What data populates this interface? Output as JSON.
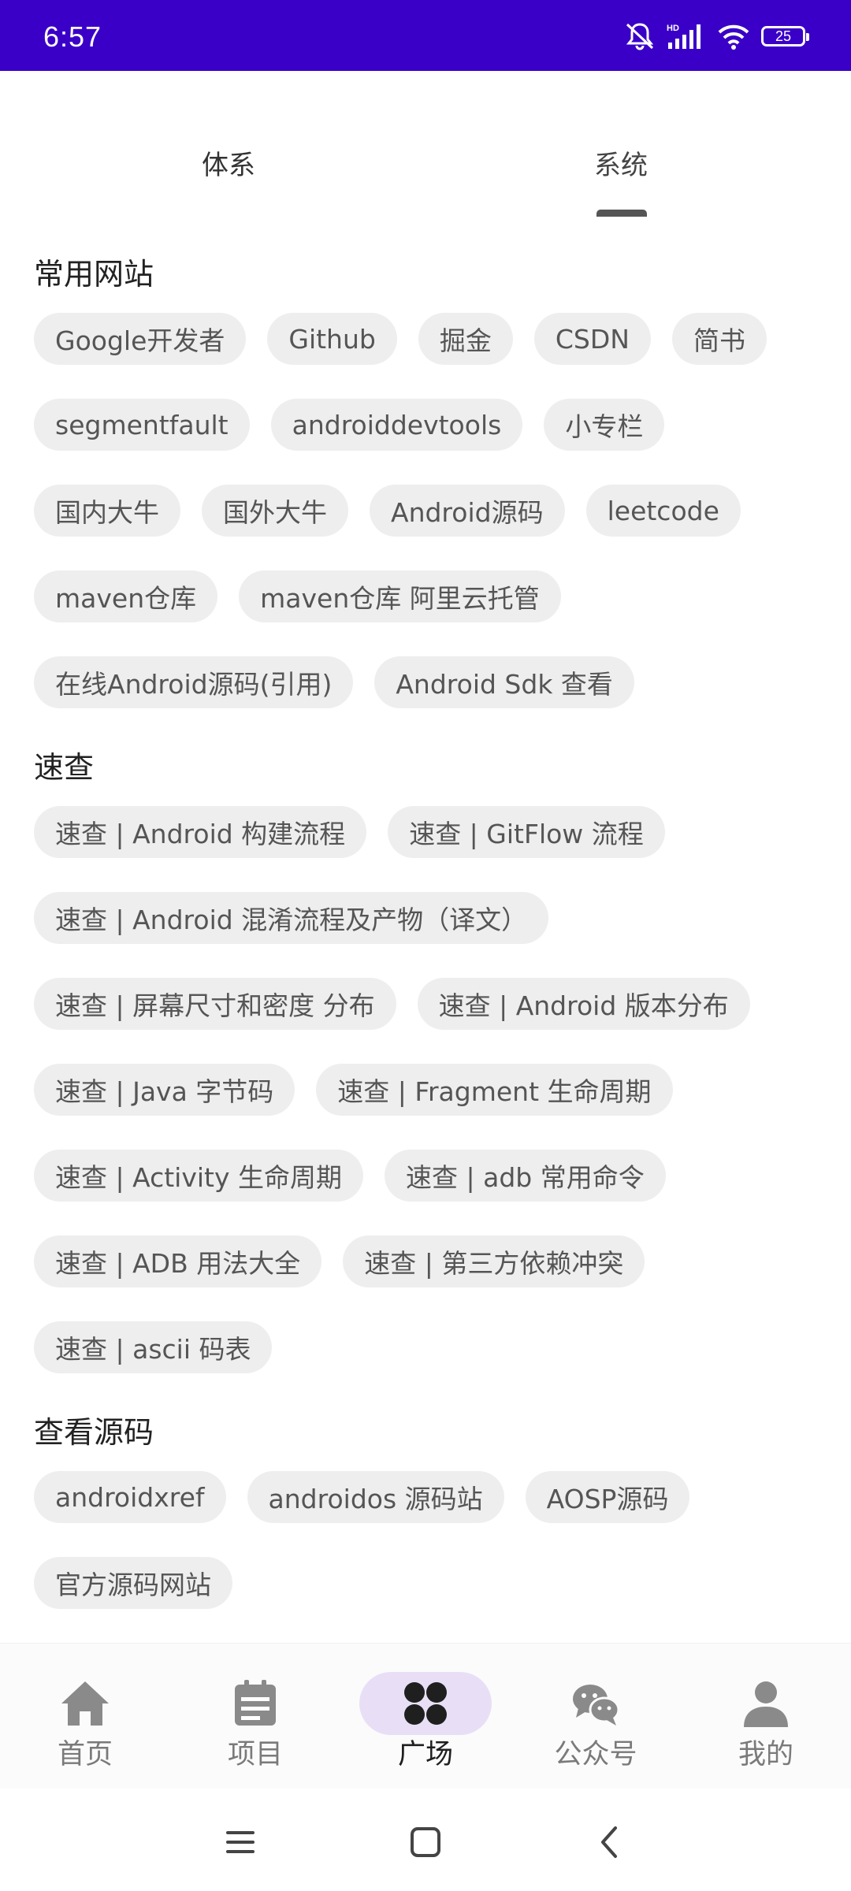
{
  "status_bar": {
    "time": "6:57",
    "battery": "25"
  },
  "tabs": [
    {
      "label": "体系",
      "active": false
    },
    {
      "label": "系统",
      "active": true
    }
  ],
  "sections": [
    {
      "title": "常用网站",
      "rows": [
        [
          "Google开发者",
          "Github",
          "掘金",
          "CSDN",
          "简书"
        ],
        [
          "segmentfault",
          "androiddevtools",
          "小专栏"
        ],
        [
          "国内大牛",
          "国外大牛",
          "Android源码",
          "leetcode"
        ],
        [
          "maven仓库",
          "maven仓库 阿里云托管"
        ],
        [
          "在线Android源码(引用)",
          "Android Sdk 查看"
        ]
      ]
    },
    {
      "title": "速查",
      "rows": [
        [
          "速查 | Android 构建流程",
          "速查 | GitFlow 流程"
        ],
        [
          "速查 | Android 混淆流程及产物（译文）"
        ],
        [
          "速查 | 屏幕尺寸和密度 分布",
          "速查 | Android 版本分布"
        ],
        [
          "速查 | Java 字节码",
          "速查 | Fragment 生命周期"
        ],
        [
          "速查 | Activity 生命周期",
          "速查 | adb 常用命令"
        ],
        [
          "速查 | ADB 用法大全",
          "速查 | 第三方依赖冲突"
        ],
        [
          "速查 | ascii 码表"
        ]
      ]
    },
    {
      "title": "查看源码",
      "rows": [
        [
          "androidxref",
          "androidos 源码站",
          "AOSP源码"
        ],
        [
          "官方源码网站"
        ]
      ]
    }
  ],
  "bottom_nav": [
    {
      "label": "首页",
      "icon": "home-icon",
      "active": false
    },
    {
      "label": "项目",
      "icon": "project-icon",
      "active": false
    },
    {
      "label": "广场",
      "icon": "square-grid-icon",
      "active": true
    },
    {
      "label": "公众号",
      "icon": "wechat-icon",
      "active": false
    },
    {
      "label": "我的",
      "icon": "person-icon",
      "active": false
    }
  ],
  "colors": {
    "status_bar": "#3a00c8",
    "chip_bg": "#eeeeee",
    "active_nav_pill": "#e8dff7"
  }
}
